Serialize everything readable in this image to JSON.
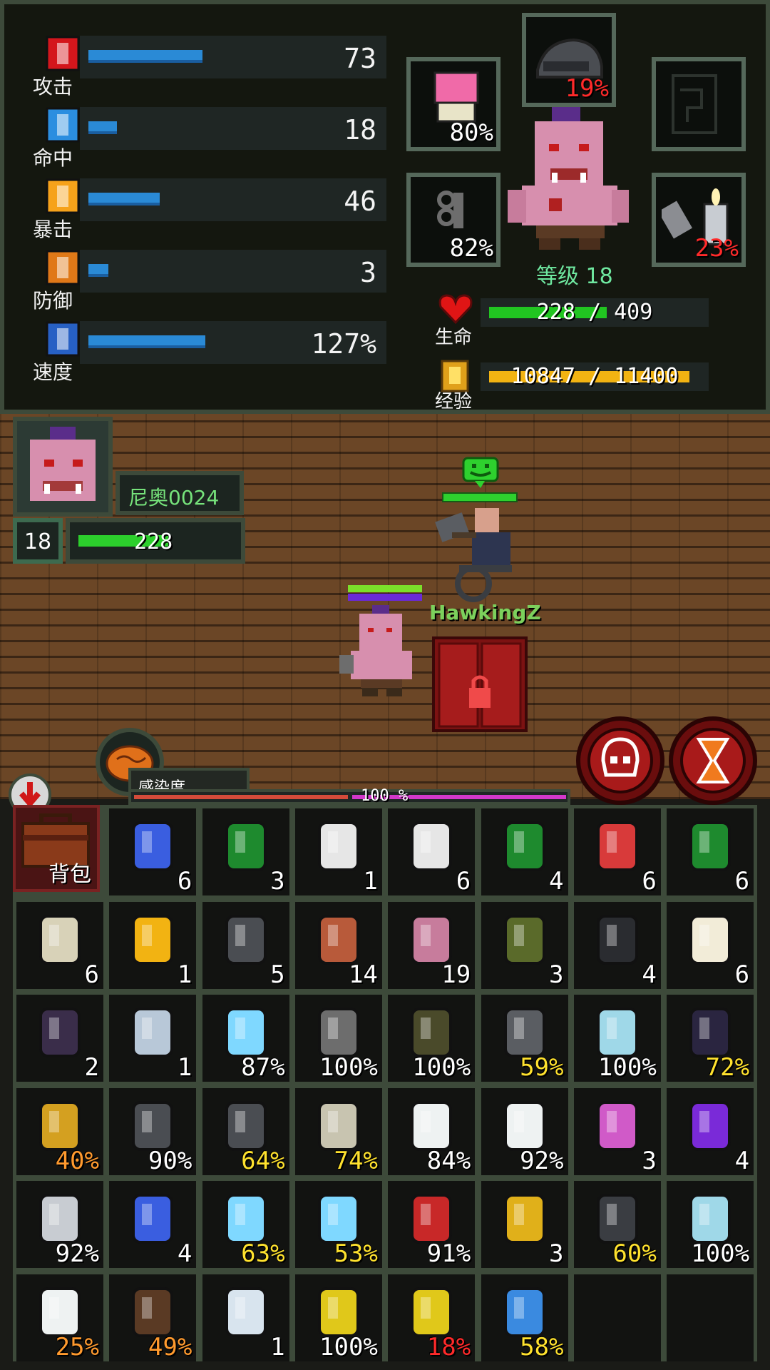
{
  "stats": [
    {
      "key": "attack",
      "label": "攻击",
      "value": "73",
      "fill": 0.4,
      "color": "#d4161c"
    },
    {
      "key": "accuracy",
      "label": "命中",
      "value": "18",
      "fill": 0.1,
      "color": "#2b8ee0"
    },
    {
      "key": "crit",
      "label": "暴击",
      "value": "46",
      "fill": 0.25,
      "color": "#f6a21a"
    },
    {
      "key": "defense",
      "label": "防御",
      "value": "3",
      "fill": 0.07,
      "color": "#e07818"
    },
    {
      "key": "speed",
      "label": "速度",
      "value": "127%",
      "fill": 0.41,
      "color": "#2760c4"
    }
  ],
  "equipment": {
    "helmet_pct": "19%",
    "armor_pct": "80%",
    "brass_knuckles_pct": "82%",
    "lighter_pct": "23%",
    "accessory_pct": ""
  },
  "character": {
    "level_text": "等级 18",
    "hp_label": "生命",
    "hp_text": "228 / 409",
    "hp_fraction": 0.557,
    "xp_label": "经验",
    "xp_text": "10847 / 11400",
    "xp_fraction": 0.95
  },
  "hud": {
    "player_name": "尼奥0024",
    "level": "18",
    "hp": "228",
    "hp_fraction": 0.557,
    "npc_name": "HawkingZ",
    "infection_label": "感染度",
    "infection_pct": "100 %"
  },
  "inventory": {
    "backpack_label": "背包",
    "rows": [
      [
        {
          "icon": "syringe-icon",
          "count": "6",
          "color": ""
        },
        {
          "icon": "green-bottle-icon",
          "count": "3",
          "color": ""
        },
        {
          "icon": "small-medkit-icon",
          "count": "1",
          "color": ""
        },
        {
          "icon": "medkit-icon",
          "count": "6",
          "color": ""
        },
        {
          "icon": "green-bottle-blue-label-icon",
          "count": "4",
          "color": ""
        },
        {
          "icon": "brain-icon",
          "count": "6",
          "color": ""
        },
        {
          "icon": "green-bottle-blue-label-icon",
          "count": "6",
          "color": ""
        }
      ],
      [
        {
          "icon": "skull-icon",
          "count": "6",
          "color": ""
        },
        {
          "icon": "yellow-bag-icon",
          "count": "1",
          "color": ""
        },
        {
          "icon": "rock-icon",
          "count": "5",
          "color": ""
        },
        {
          "icon": "potted-plant-icon",
          "count": "14",
          "color": ""
        },
        {
          "icon": "flesh-icon",
          "count": "19",
          "color": ""
        },
        {
          "icon": "grenade-icon",
          "count": "3",
          "color": ""
        },
        {
          "icon": "dumbbell-icon",
          "count": "4",
          "color": ""
        },
        {
          "icon": "bone-icon",
          "count": "6",
          "color": ""
        }
      ],
      [
        {
          "icon": "bomb-icon",
          "count": "2",
          "color": ""
        },
        {
          "icon": "flask-icon",
          "count": "1",
          "color": ""
        },
        {
          "icon": "light-saber-icon",
          "count": "87%",
          "color": ""
        },
        {
          "icon": "brass-knuckles-icon",
          "count": "100%",
          "color": ""
        },
        {
          "icon": "rocket-launcher-icon",
          "count": "100%",
          "color": ""
        },
        {
          "icon": "rifle-icon",
          "count": "59%",
          "color": "yellow"
        },
        {
          "icon": "ray-gun-icon",
          "count": "100%",
          "color": ""
        },
        {
          "icon": "dark-armor-icon",
          "count": "72%",
          "color": "yellow"
        }
      ],
      [
        {
          "icon": "gold-arm-icon",
          "count": "40%",
          "color": "orange"
        },
        {
          "icon": "gas-mask-icon",
          "count": "90%",
          "color": ""
        },
        {
          "icon": "gas-mask-icon",
          "count": "64%",
          "color": "yellow"
        },
        {
          "icon": "helmet-icon",
          "count": "74%",
          "color": "yellow"
        },
        {
          "icon": "lab-coat-icon",
          "count": "84%",
          "color": ""
        },
        {
          "icon": "lab-coat-icon",
          "count": "92%",
          "color": ""
        },
        {
          "icon": "potion-icon",
          "count": "3",
          "color": ""
        },
        {
          "icon": "purple-vial-icon",
          "count": "4",
          "color": ""
        }
      ],
      [
        {
          "icon": "lighter-icon",
          "count": "92%",
          "color": ""
        },
        {
          "icon": "blue-syringe-icon",
          "count": "4",
          "color": ""
        },
        {
          "icon": "light-saber-icon",
          "count": "63%",
          "color": "yellow"
        },
        {
          "icon": "light-saber-icon",
          "count": "53%",
          "color": "yellow"
        },
        {
          "icon": "axe-icon",
          "count": "91%",
          "color": ""
        },
        {
          "icon": "key-icon",
          "count": "3",
          "color": ""
        },
        {
          "icon": "camera-icon",
          "count": "60%",
          "color": "yellow"
        },
        {
          "icon": "ray-gun-icon",
          "count": "100%",
          "color": ""
        }
      ],
      [
        {
          "icon": "lab-coat-icon",
          "count": "25%",
          "color": "orange"
        },
        {
          "icon": "minigun-icon",
          "count": "49%",
          "color": "orange"
        },
        {
          "icon": "medicine-bottle-icon",
          "count": "1",
          "color": ""
        },
        {
          "icon": "whip-icon",
          "count": "100%",
          "color": ""
        },
        {
          "icon": "whip-icon",
          "count": "18%",
          "color": "red"
        },
        {
          "icon": "blue-blade-icon",
          "count": "58%",
          "color": "yellow"
        },
        {
          "icon": "",
          "count": "",
          "color": ""
        },
        {
          "icon": "",
          "count": "",
          "color": ""
        }
      ]
    ]
  }
}
